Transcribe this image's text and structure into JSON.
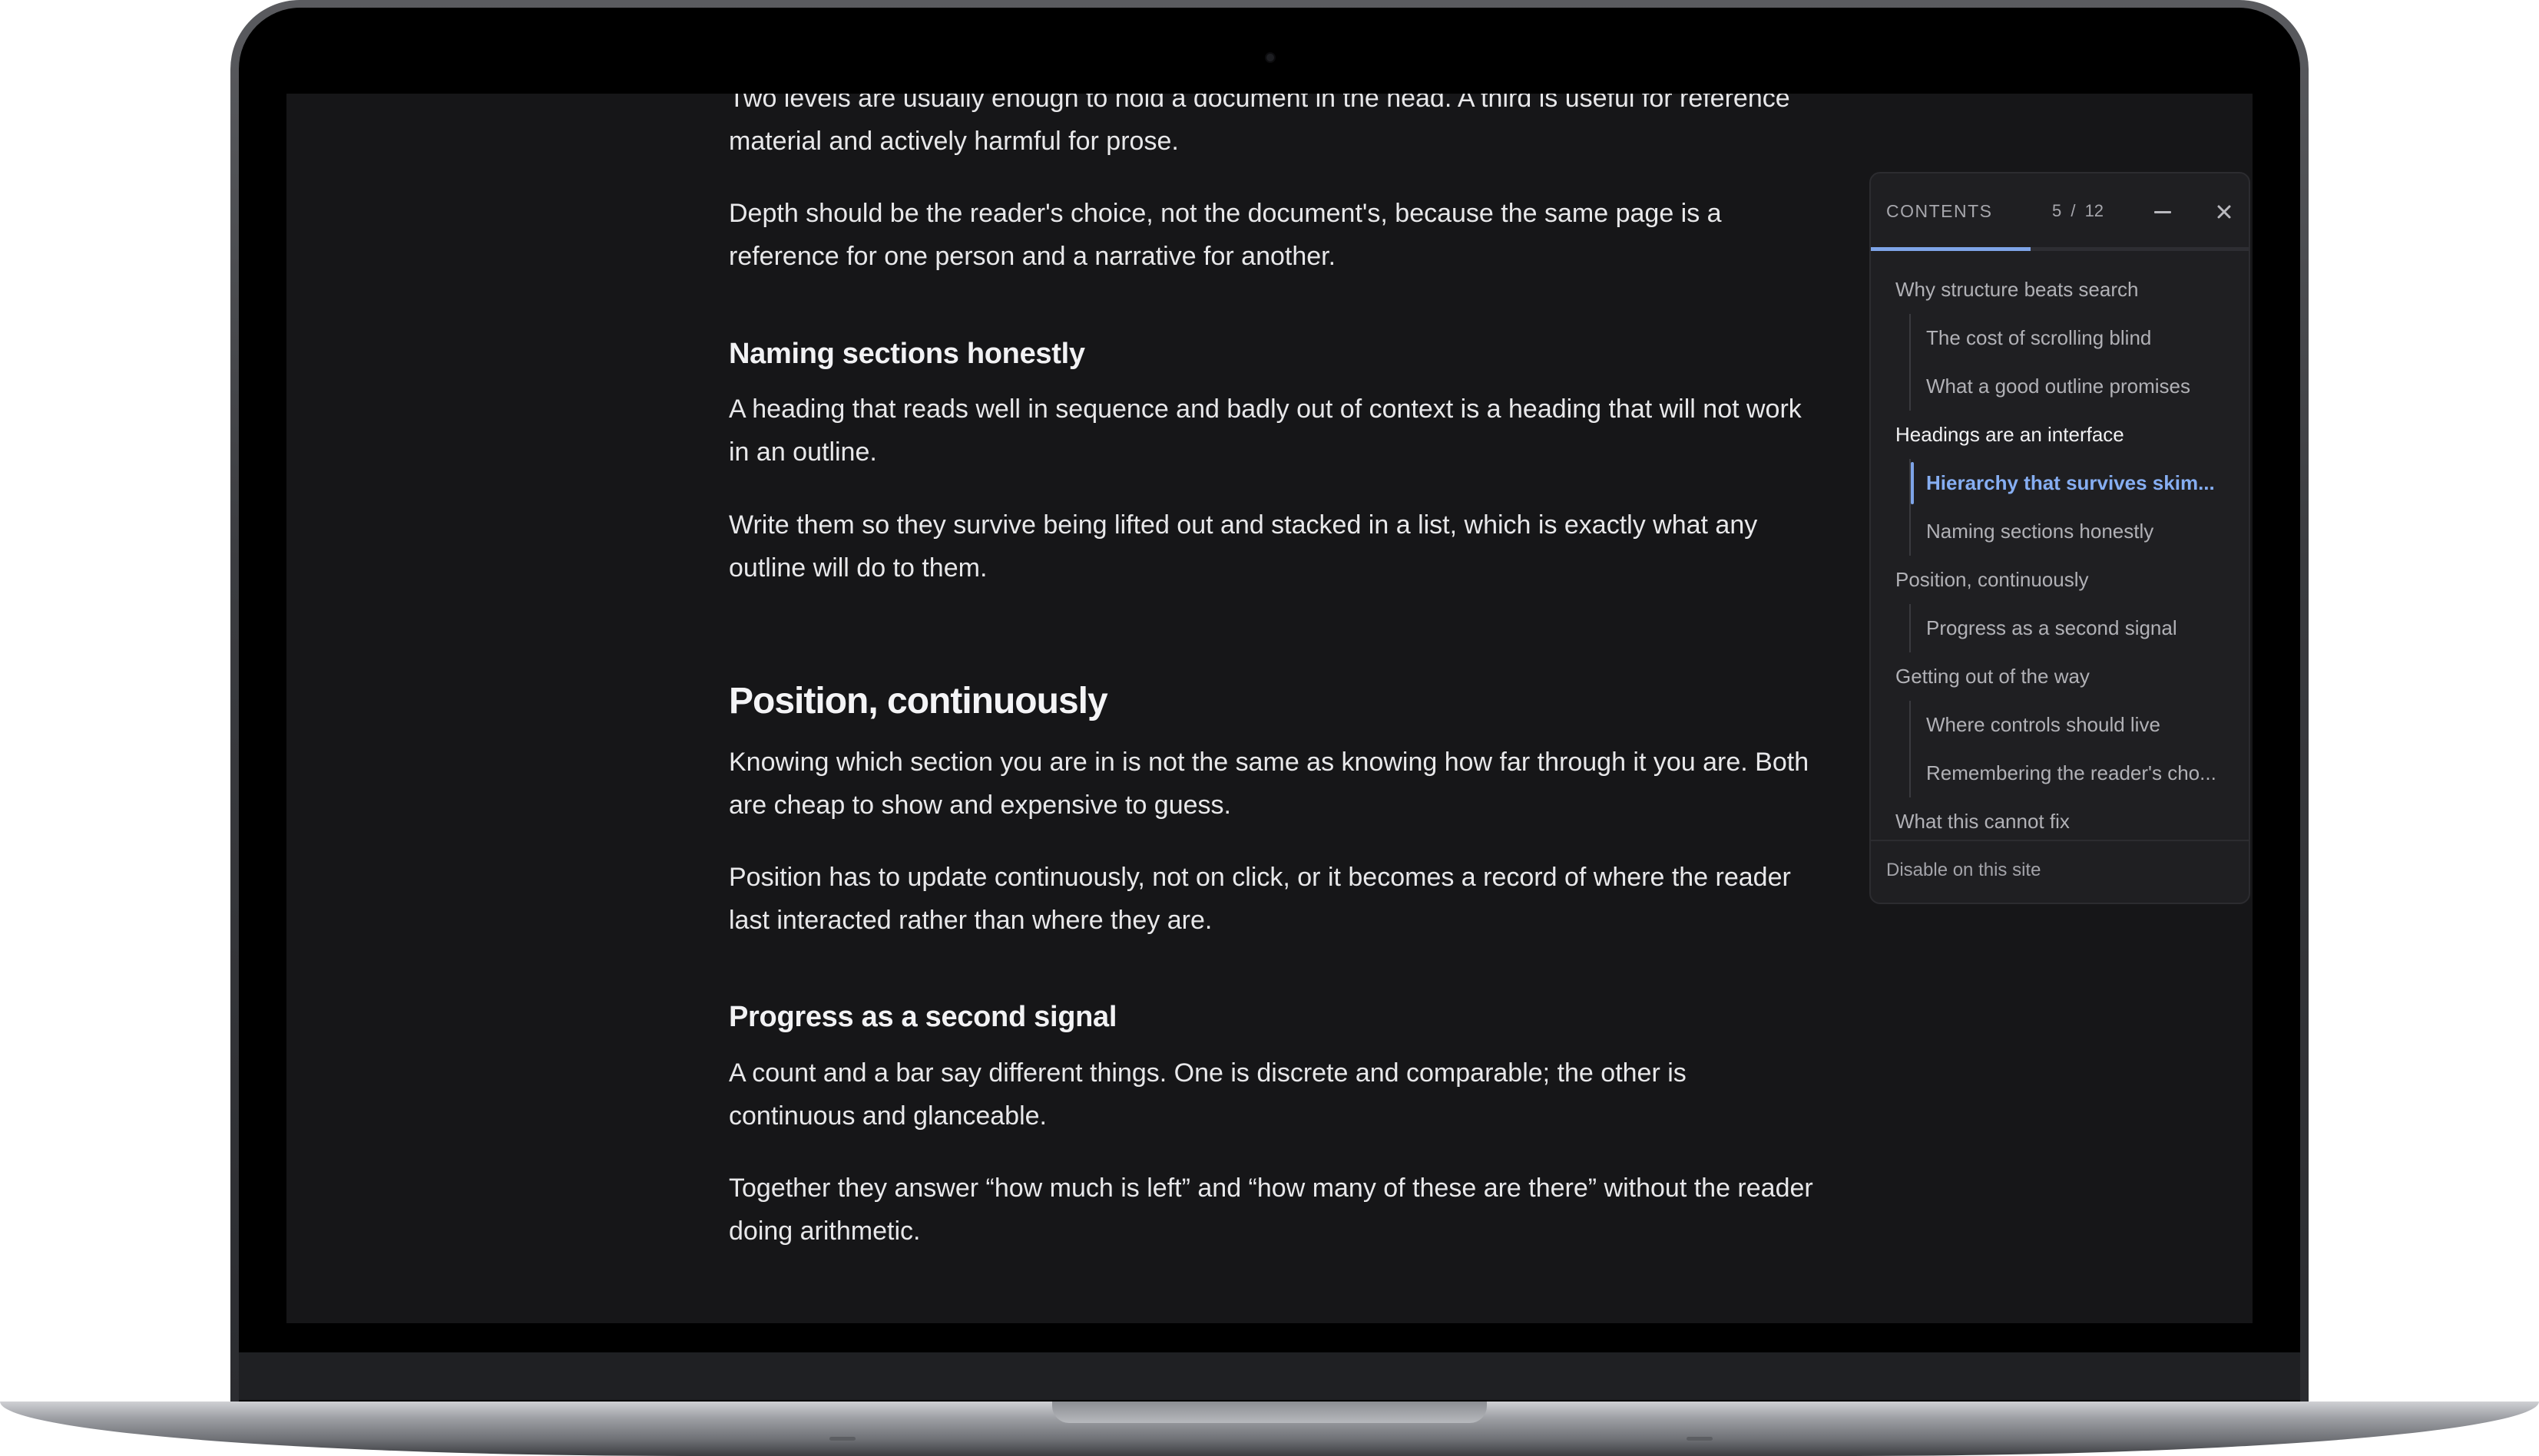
{
  "article": {
    "p1": "Two levels are usually enough to hold a document in the head. A third is useful for reference material and actively harmful for prose.",
    "p2": "Depth should be the reader's choice, not the document's, because the same page is a reference for one person and a narrative for another.",
    "h_naming": "Naming sections honestly",
    "p3": "A heading that reads well in sequence and badly out of context is a heading that will not work in an outline.",
    "p4": "Write them so they survive being lifted out and stacked in a list, which is exactly what any outline will do to them.",
    "h_position": "Position, continuously",
    "p5": "Knowing which section you are in is not the same as knowing how far through it you are. Both are cheap to show and expensive to guess.",
    "p6": "Position has to update continuously, not on click, or it becomes a record of where the reader last interacted rather than where they are.",
    "h_progress": "Progress as a second signal",
    "p7": "A count and a bar say different things. One is discrete and comparable; the other is continuous and glanceable.",
    "p8": "Together they answer “how much is left” and “how many of these are there” without the reader doing arithmetic."
  },
  "toc": {
    "title": "CONTENTS",
    "count": "5 / 12",
    "progress_fraction": 0.42,
    "accent_color": "#7ea4e8",
    "minimize_icon": "minus-icon",
    "close_icon": "close-icon",
    "items": [
      {
        "label": "Why structure beats search",
        "level": 1,
        "state": "normal"
      },
      {
        "label": "The cost of scrolling blind",
        "level": 2,
        "state": "normal"
      },
      {
        "label": "What a good outline promises",
        "level": 2,
        "state": "normal"
      },
      {
        "label": "Headings are an interface",
        "level": 1,
        "state": "parent"
      },
      {
        "label": "Hierarchy that survives skim...",
        "level": 2,
        "state": "active"
      },
      {
        "label": "Naming sections honestly",
        "level": 2,
        "state": "normal"
      },
      {
        "label": "Position, continuously",
        "level": 1,
        "state": "normal"
      },
      {
        "label": "Progress as a second signal",
        "level": 2,
        "state": "normal"
      },
      {
        "label": "Getting out of the way",
        "level": 1,
        "state": "normal"
      },
      {
        "label": "Where controls should live",
        "level": 2,
        "state": "normal"
      },
      {
        "label": "Remembering the reader's cho...",
        "level": 2,
        "state": "normal"
      },
      {
        "label": "What this cannot fix",
        "level": 1,
        "state": "normal"
      }
    ],
    "footer": "Disable on this site"
  }
}
